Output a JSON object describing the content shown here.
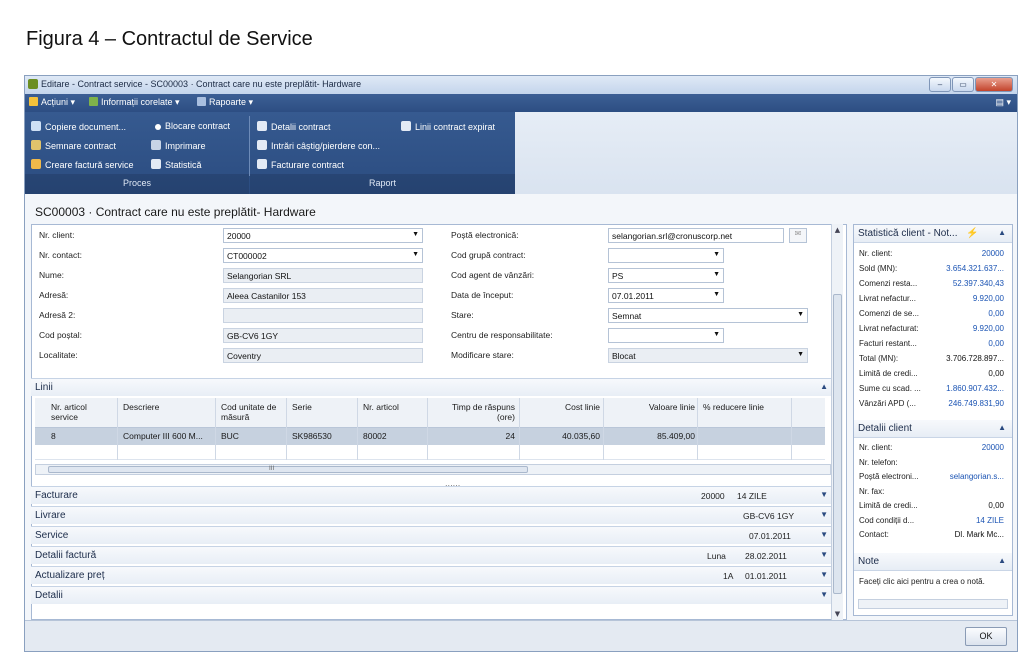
{
  "caption": "Figura 4 – Contractul de Service",
  "window": {
    "title": "Editare - Contract service - SC00003 · Contract care nu este preplătit- Hardware",
    "controls": [
      "–",
      "▭",
      "✕"
    ]
  },
  "menu": {
    "actions": "Acțiuni",
    "related": "Informații corelate",
    "reports": "Rapoarte"
  },
  "ribbon": {
    "process_items": [
      "Copiere document...",
      "Semnare contract",
      "Creare factură service",
      "Blocare contract",
      "Imprimare",
      "Statistică"
    ],
    "report_items": [
      "Detalii contract",
      "Intrări câștig/pierdere con...",
      "Facturare contract",
      "Linii contract expirat"
    ],
    "group_process": "Proces",
    "group_report": "Raport"
  },
  "page_title": "SC00003 · Contract care nu este preplătit- Hardware",
  "general": {
    "nr_client_label": "Nr. client:",
    "nr_client": "20000",
    "nr_contact_label": "Nr. contact:",
    "nr_contact": "CT000002",
    "nume_label": "Nume:",
    "nume": "Selangorian SRL",
    "adresa_label": "Adresă:",
    "adresa": "Aleea Castanilor 153",
    "adresa2_label": "Adresă 2:",
    "adresa2": "",
    "cod_postal_label": "Cod poștal:",
    "cod_postal": "GB-CV6 1GY",
    "localitate_label": "Localitate:",
    "localitate": "Coventry",
    "email_label": "Poștă electronică:",
    "email": "selangorian.srl@cronuscorp.net",
    "cod_grupa_label": "Cod grupă contract:",
    "cod_grupa": "",
    "cod_agent_label": "Cod agent de vânzări:",
    "cod_agent": "PS",
    "data_inceput_label": "Data de început:",
    "data_inceput": "07.01.2011",
    "stare_label": "Stare:",
    "stare": "Semnat",
    "centru_label": "Centru de responsabilitate:",
    "centru": "",
    "modificare_label": "Modificare stare:",
    "modificare": "Blocat"
  },
  "lines": {
    "title": "Linii",
    "columns": [
      "Nr. articol service",
      "Descriere",
      "Cod unitate de măsură",
      "Serie",
      "Nr. articol",
      "Timp de răspuns (ore)",
      "Cost linie",
      "Valoare linie",
      "% reducere linie"
    ],
    "rows": [
      [
        "8",
        "Computer III 600 M...",
        "BUC",
        "SK986530",
        "80002",
        "24",
        "40.035,60",
        "85.409,00",
        ""
      ]
    ],
    "scroll_mark": "III"
  },
  "sections": [
    {
      "title": "Facturare",
      "values": [
        "20000",
        "14 ZILE"
      ]
    },
    {
      "title": "Livrare",
      "values": [
        "GB-CV6 1GY"
      ]
    },
    {
      "title": "Service",
      "values": [
        "07.01.2011"
      ]
    },
    {
      "title": "Detalii factură",
      "values": [
        "Luna",
        "28.02.2011"
      ]
    },
    {
      "title": "Actualizare preț",
      "values": [
        "1A",
        "01.01.2011"
      ]
    },
    {
      "title": "Detalii",
      "values": []
    }
  ],
  "factbox_stats": {
    "title": "Statistică client - Not...",
    "rows": [
      {
        "label": "Nr. client:",
        "value": "20000"
      },
      {
        "label": "Sold (MN):",
        "value": "3.654.321.637..."
      },
      {
        "label": "Comenzi resta...",
        "value": "52.397.340,43"
      },
      {
        "label": "Livrat nefactur...",
        "value": "9.920,00"
      },
      {
        "label": "Comenzi de se...",
        "value": "0,00"
      },
      {
        "label": "Livrat nefacturat:",
        "value": "9.920,00"
      },
      {
        "label": "Facturi restant...",
        "value": "0,00"
      },
      {
        "label": "Total (MN):",
        "value": "3.706.728.897..."
      },
      {
        "label": "Limită de credi...",
        "value": "0,00"
      },
      {
        "label": "Sume cu scad. ...",
        "value": "1.860.907.432..."
      },
      {
        "label": "Vânzări APD (...",
        "value": "246.749.831,90"
      }
    ]
  },
  "factbox_client": {
    "title": "Detalii client",
    "rows": [
      {
        "label": "Nr. client:",
        "value": "20000"
      },
      {
        "label": "Nr. telefon:",
        "value": ""
      },
      {
        "label": "Poștă electroni...",
        "value": "selangorian.s..."
      },
      {
        "label": "Nr. fax:",
        "value": ""
      },
      {
        "label": "Limită de credi...",
        "value": "0,00"
      },
      {
        "label": "Cod condiții d...",
        "value": "14 ZILE"
      },
      {
        "label": "Contact:",
        "value": "Dl. Mark Mc..."
      }
    ]
  },
  "factbox_notes": {
    "title": "Note",
    "text": "Faceți clic aici pentru a crea o notă."
  },
  "ok_button": "OK",
  "colors": {
    "accent": "#2d4e83",
    "link": "#1a53b3"
  }
}
